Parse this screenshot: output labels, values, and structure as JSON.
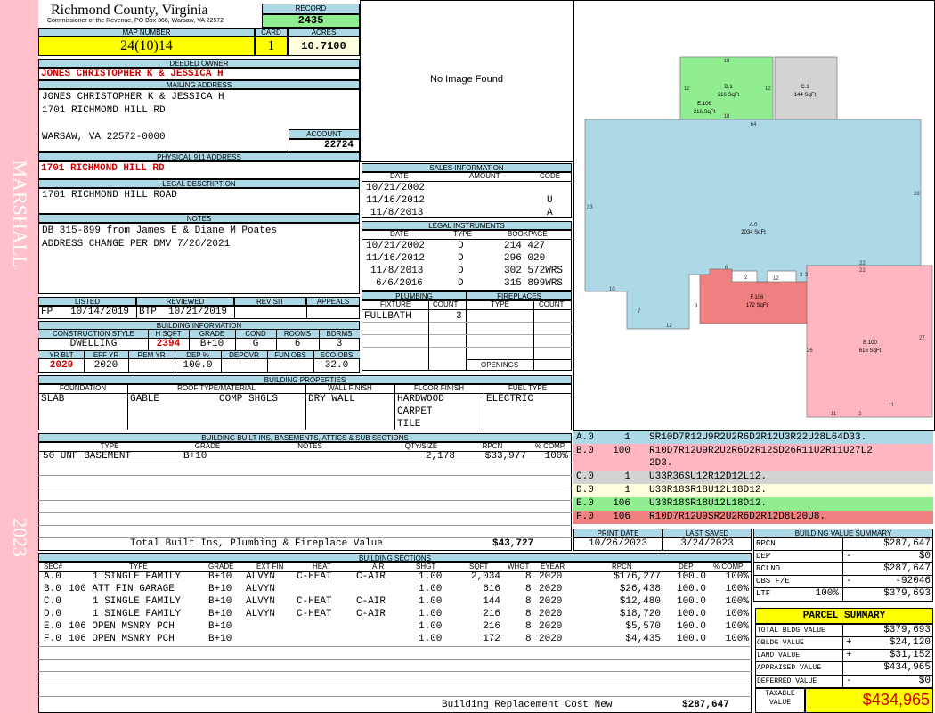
{
  "sidebar": {
    "district": "MARSHALL",
    "year": "2023"
  },
  "header": {
    "county": "Richmond County, Virginia",
    "office": "Commissioner of the Revenue, PO Box 366, Warsaw, VA 22572",
    "record_label": "RECORD",
    "record": "2435",
    "map_label": "MAP NUMBER",
    "map": "24(10)14",
    "card_label": "CARD",
    "card": "1",
    "acres_label": "ACRES",
    "acres": "10.7100"
  },
  "owner": {
    "deeded_label": "DEEDED OWNER",
    "deeded": "JONES CHRISTOPHER K & JESSICA H",
    "mailing_label": "MAILING ADDRESS",
    "mailing": [
      "JONES CHRISTOPHER K & JESSICA H",
      "1701 RICHMOND HILL RD",
      "WARSAW, VA 22572-0000"
    ],
    "account_label": "ACCOUNT",
    "account": "22724",
    "physical_label": "PHYSICAL 911 ADDRESS",
    "physical": "1701 RICHMOND HILL RD",
    "legal_label": "LEGAL DESCRIPTION",
    "legal": "1701 RICHMOND HILL ROAD",
    "notes_label": "NOTES",
    "notes": [
      "DB 315-899 from James E & Diane M Poates",
      "ADDRESS CHANGE PER DMV 7/26/2021"
    ]
  },
  "image": {
    "placeholder": "No Image Found"
  },
  "sales": {
    "title": "SALES INFORMATION",
    "headers": [
      "DATE",
      "AMOUNT",
      "CODE"
    ],
    "rows": [
      [
        "10/21/2002",
        "",
        ""
      ],
      [
        "11/16/2012",
        "",
        "U"
      ],
      [
        "11/8/2013",
        "",
        "A"
      ]
    ]
  },
  "instruments": {
    "title": "LEGAL INSTRUMENTS",
    "headers": [
      "DATE",
      "TYPE",
      "BOOKPAGE"
    ],
    "rows": [
      [
        "10/21/2002",
        "D",
        "214 427"
      ],
      [
        "11/16/2012",
        "D",
        "296 020"
      ],
      [
        "11/8/2013",
        "D",
        "302 572WRS"
      ],
      [
        "6/6/2016",
        "D",
        "315 899WRS"
      ]
    ]
  },
  "status": {
    "headers": [
      "LISTED",
      "REVIEWED",
      "REVISIT",
      "APPEALS"
    ],
    "listed": "FP   10/14/2019",
    "reviewed": "BTP  10/21/2019",
    "revisit": "",
    "appeals": ""
  },
  "plumbing": {
    "title": "PLUMBING",
    "headers": [
      "FIXTURE",
      "COUNT"
    ],
    "rows": [
      [
        "FULLBATH",
        "3"
      ]
    ]
  },
  "fireplaces": {
    "title": "FIREPLACES",
    "headers": [
      "TYPE",
      "COUNT"
    ],
    "openings_label": "OPENINGS"
  },
  "building_info": {
    "title": "BUILDING INFORMATION",
    "headers1": [
      "CONSTRUCTION STYLE",
      "H SQFT",
      "GRADE",
      "COND",
      "ROOMS",
      "BDRMS"
    ],
    "values1": [
      "DWELLING",
      "2394",
      "B+10",
      "G",
      "6",
      "3"
    ],
    "headers2": [
      "YR BLT",
      "EFF YR",
      "REM YR",
      "DEP %",
      "DEPOVR",
      "FUN OBS",
      "ECO OBS"
    ],
    "values2": [
      "2020",
      "2020",
      "",
      "100.0",
      "",
      "",
      "32.0"
    ]
  },
  "properties": {
    "title": "BUILDING PROPERTIES",
    "headers": [
      "FOUNDATION",
      "ROOF TYPE/MATERIAL",
      "WALL FINISH",
      "FLOOR FINISH",
      "FUEL TYPE"
    ],
    "foundation": "SLAB",
    "roof_type": "GABLE",
    "roof_material": "COMP SHGLS",
    "wall": "DRY WALL",
    "floor": [
      "HARDWOOD",
      "CARPET",
      "TILE"
    ],
    "fuel": "ELECTRIC"
  },
  "builtins": {
    "title": "BUILDING BUILT INS, BASEMENTS, ATTICS & SUB SECTIONS",
    "headers": [
      "TYPE",
      "GRADE",
      "NOTES",
      "QTY/SIZE",
      "RPCN",
      "% COMP"
    ],
    "rows": [
      [
        "50 UNF BASEMENT",
        "B+10",
        "",
        "2,178",
        "$33,977",
        "100%"
      ]
    ],
    "total_label": "Total Built Ins, Plumbing & Fireplace Value",
    "total": "$43,727"
  },
  "sketch": {
    "areas": [
      {
        "name": "A.0",
        "label": "A.0",
        "sqft": "2034 SqFt",
        "color": "#add8e6"
      },
      {
        "name": "B.100",
        "label": "B.100",
        "sqft": "616 SqFt",
        "color": "#ffb6c1"
      },
      {
        "name": "C.1",
        "label": "C.1",
        "sqft": "144 SqFt",
        "color": "#d3d3d3"
      },
      {
        "name": "D.1",
        "label": "D.1",
        "sqft": "216 SqFt",
        "color": "#90ee90"
      },
      {
        "name": "E.106",
        "label": "E.106",
        "sqft": "216 SqFt",
        "color": "#90ee90"
      },
      {
        "name": "F.106",
        "label": "F.106",
        "sqft": "172 SqFt",
        "color": "#f08080"
      }
    ],
    "dims": [
      "18",
      "12",
      "12",
      "18",
      "64",
      "28",
      "33",
      "6",
      "2",
      "12",
      "3",
      "3",
      "22",
      "22",
      "10",
      "7",
      "12",
      "9",
      "27",
      "26",
      "11",
      "2",
      "11"
    ]
  },
  "vectors": [
    {
      "sec": "A.0",
      "code": "1",
      "vec": "SR10D7R12U9R2U2R6D2R12U3R22U28L64D33.",
      "color": "#add8e6"
    },
    {
      "sec": "B.0",
      "code": "100",
      "vec": "R10D7R12U9R2U2R6D2R12SD26R11U2R11U27L2",
      "vec2": "2D3.",
      "color": "#ffb6c1"
    },
    {
      "sec": "C.0",
      "code": "1",
      "vec": "U33R36SU12R12D12L12.",
      "color": "#d3d3d3"
    },
    {
      "sec": "D.0",
      "code": "1",
      "vec": "U33R18SR18U12L18D12.",
      "color": "#ffffe0"
    },
    {
      "sec": "E.0",
      "code": "106",
      "vec": "U33R18SR18U12L18D12.",
      "color": "#90ee90"
    },
    {
      "sec": "F.0",
      "code": "106",
      "vec": "R10D7R12U9SR2U2R6D2R12D8L20U8.",
      "color": "#f08080"
    }
  ],
  "dates": {
    "print_label": "PRINT DATE",
    "print": "10/26/2023",
    "saved_label": "LAST SAVED",
    "saved": "3/24/2023"
  },
  "bvs": {
    "title": "BUILDING VALUE SUMMARY",
    "rows": [
      {
        "label": "RPCN",
        "sign": "",
        "value": "$287,647"
      },
      {
        "label": "DEP",
        "sign": "-",
        "value": "$0"
      },
      {
        "label": "RCLND",
        "sign": "",
        "value": "$287,647"
      },
      {
        "label": "OBS F/E",
        "sign": "-",
        "value": "-92046"
      },
      {
        "label": "LTF",
        "pct": "100%",
        "sign": "",
        "value": "$379,693"
      }
    ]
  },
  "parcel": {
    "title": "PARCEL SUMMARY",
    "rows": [
      {
        "label": "TOTAL BLDG VALUE",
        "sign": "",
        "value": "$379,693"
      },
      {
        "label": "OBLDG VALUE",
        "sign": "+",
        "value": "$24,120"
      },
      {
        "label": "LAND VALUE",
        "sign": "+",
        "value": "$31,152"
      },
      {
        "label": "APPRAISED VALUE",
        "sign": "",
        "value": "$434,965"
      },
      {
        "label": "DEFERRED VALUE",
        "sign": "-",
        "value": "$0"
      }
    ],
    "taxable_label1": "TAXABLE",
    "taxable_label2": "VALUE",
    "taxable": "$434,965"
  },
  "sections": {
    "title": "BUILDING SECTIONS",
    "headers": [
      "SEC#",
      "TYPE",
      "GRADE",
      "EXT FIN",
      "HEAT",
      "AIR",
      "SHGT",
      "SQFT",
      "WHGT",
      "EYEAR",
      "RPCN",
      "DEP",
      "% COMP"
    ],
    "rows": [
      [
        "A.0",
        "1 SINGLE FAMILY",
        "B+10",
        "ALVYN",
        "C-HEAT",
        "C-AIR",
        "1.00",
        "2,034",
        "8",
        "2020",
        "$176,277",
        "100.0",
        "100%"
      ],
      [
        "B.0",
        "100 ATT FIN GARAGE",
        "B+10",
        "ALVYN",
        "",
        "",
        "1.00",
        "616",
        "8",
        "2020",
        "$26,438",
        "100.0",
        "100%"
      ],
      [
        "C.0",
        "1 SINGLE FAMILY",
        "B+10",
        "ALVYN",
        "C-HEAT",
        "C-AIR",
        "1.00",
        "144",
        "8",
        "2020",
        "$12,480",
        "100.0",
        "100%"
      ],
      [
        "D.0",
        "1 SINGLE FAMILY",
        "B+10",
        "ALVYN",
        "C-HEAT",
        "C-AIR",
        "1.00",
        "216",
        "8",
        "2020",
        "$18,720",
        "100.0",
        "100%"
      ],
      [
        "E.0",
        "106 OPEN MSNRY PCH",
        "B+10",
        "",
        "",
        "",
        "1.00",
        "216",
        "8",
        "2020",
        "$5,570",
        "100.0",
        "100%"
      ],
      [
        "F.0",
        "106 OPEN MSNRY PCH",
        "B+10",
        "",
        "",
        "",
        "1.00",
        "172",
        "8",
        "2020",
        "$4,435",
        "100.0",
        "100%"
      ]
    ],
    "total_label": "Building Replacement Cost New",
    "total": "$287,647"
  }
}
